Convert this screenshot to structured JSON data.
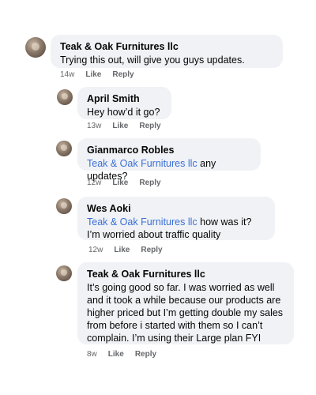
{
  "comments": [
    {
      "author": "Teak & Oak Furnitures llc",
      "text": "Trying this out, will give you guys updates.",
      "time": "14w",
      "like": "Like",
      "reply": "Reply"
    },
    {
      "author": "April Smith",
      "text": "Hey how’d it go?",
      "time": "13w",
      "like": "Like",
      "reply": "Reply"
    },
    {
      "author": "Gianmarco Robles",
      "mention": "Teak & Oak Furnitures llc",
      "text": "any updates?",
      "time": "12w",
      "like": "Like",
      "reply": "Reply"
    },
    {
      "author": "Wes Aoki",
      "mention": "Teak & Oak Furnitures llc",
      "text": "how was it? I’m worried about traffic quality",
      "time": "12w",
      "like": "Like",
      "reply": "Reply"
    },
    {
      "author": "Teak & Oak Furnitures llc",
      "text": "It’s going good so far. I was worried as well and it took a while because our products are higher priced but I’m getting double my sales from before i started with them so I can’t complain. I’m using their Large plan FYI",
      "time": "8w",
      "like": "Like",
      "reply": "Reply"
    }
  ]
}
